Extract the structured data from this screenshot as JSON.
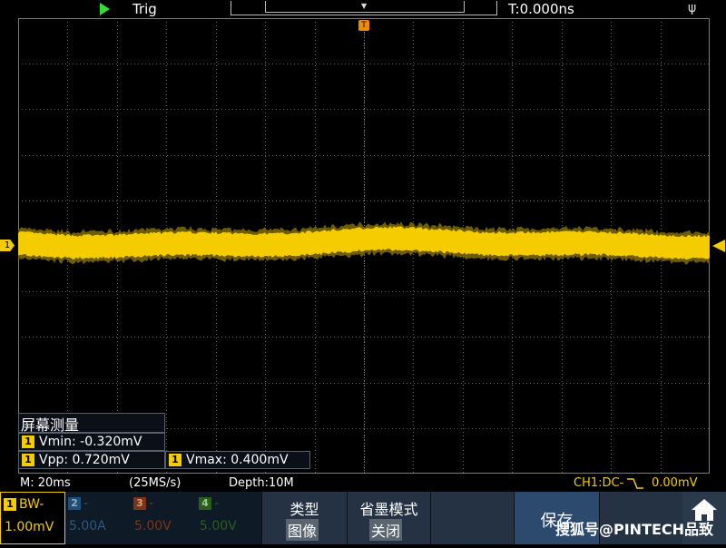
{
  "topbar": {
    "trig_label": "Trig",
    "time_offset": "T:0.000ns",
    "run_icon": "play-icon",
    "usb_icon": "usb-icon"
  },
  "colors": {
    "ch1": "#f5cc00",
    "trigger_marker": "#f08c00",
    "run": "#33dd33",
    "grid": "#6a6a6a"
  },
  "trigger_marker": "T",
  "ch1_marker": "1",
  "measurements": {
    "title": "屏幕测量",
    "items": [
      {
        "channel": "1",
        "text": "Vmin: -0.320mV"
      },
      {
        "channel": "1",
        "text": "Vpp: 0.720mV"
      },
      {
        "channel": "1",
        "text": "Vmax: 0.400mV"
      }
    ]
  },
  "status": {
    "timebase": "M: 20ms",
    "sample_rate": "(25MS/s)",
    "depth": "Depth:10M",
    "ch1_coupling": "CH1:DC-",
    "ch1_offset": "0.00mV"
  },
  "channels": [
    {
      "num": "1",
      "bw": "BW-",
      "scale": "1.00mV",
      "color": "#f5cc00",
      "active": true
    },
    {
      "num": "2",
      "bw": "-",
      "scale": "5.00A",
      "color": "#1e4f78",
      "active": false
    },
    {
      "num": "3",
      "bw": "-",
      "scale": "5.00V",
      "color": "#7a3418",
      "active": false
    },
    {
      "num": "4",
      "bw": "-",
      "scale": "5.00V",
      "color": "#2b5c1e",
      "active": false
    }
  ],
  "softkeys": {
    "type_label": "类型",
    "type_value": "图像",
    "ink_label": "省墨模式",
    "ink_value": "关闭",
    "save_label": "保存",
    "home_icon": "home-icon"
  },
  "watermark": "搜狐号@PINTECH品致"
}
